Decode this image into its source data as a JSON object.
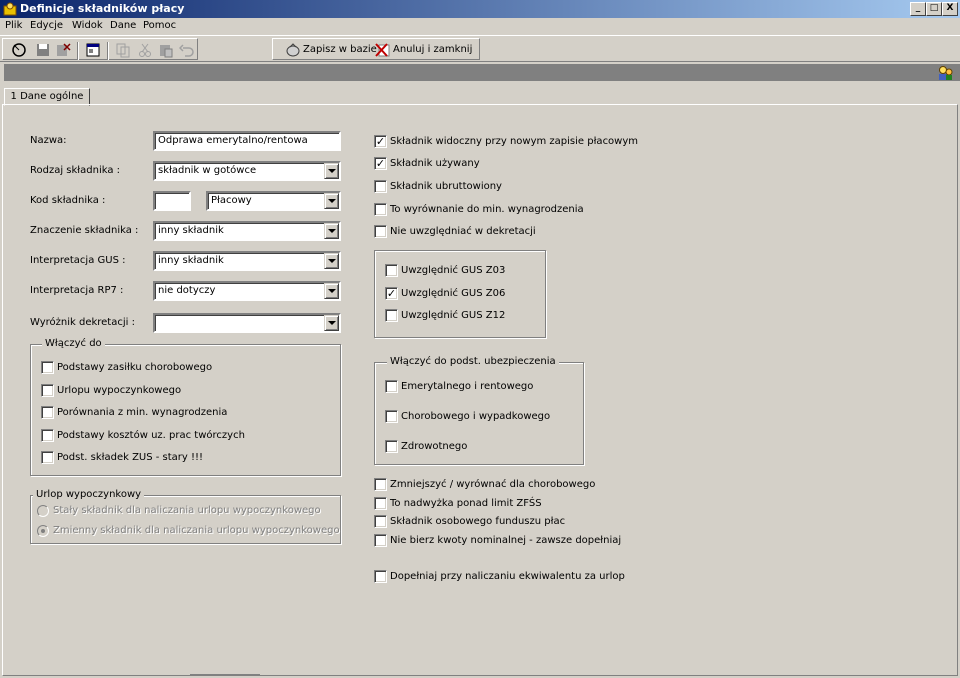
{
  "window": {
    "title": "Definicje składników płacy",
    "min_label": "_",
    "max_label": "□",
    "close_label": "X"
  },
  "menu": [
    "Plik",
    "Edycje",
    "Widok",
    "Dane",
    "Pomoc"
  ],
  "toolbar": {
    "save_label": "Zapisz w bazie",
    "cancel_label": "Anuluj i zamknij"
  },
  "tabs": [
    {
      "label": "1 Dane ogólne"
    }
  ],
  "form": {
    "nazwa": {
      "label": "Nazwa:",
      "value": "Odprawa emerytalno/rentowa"
    },
    "rodzaj": {
      "label": "Rodzaj składnika :",
      "value": "składnik w gotówce"
    },
    "kod": {
      "label": "Kod składnika :",
      "value": "",
      "type_value": "Płacowy"
    },
    "znaczenie": {
      "label": "Znaczenie składnika :",
      "value": "inny składnik"
    },
    "gus": {
      "label": "Interpretacja GUS :",
      "value": "inny składnik"
    },
    "rp7": {
      "label": "Interpretacja RP7 :",
      "value": "nie dotyczy"
    },
    "wyroznik": {
      "label": "Wyróżnik dekretacji :",
      "value": ""
    }
  },
  "wlaczyc_do": {
    "title": "Włączyć do",
    "items": [
      {
        "label": "Podstawy zasiłku chorobowego",
        "checked": false
      },
      {
        "label": "Urlopu wypoczynkowego",
        "checked": false
      },
      {
        "label": "Porównania z min. wynagrodzenia",
        "checked": false
      },
      {
        "label": "Podstawy kosztów uz. prac twórczych",
        "checked": false
      },
      {
        "label": "Podst. składek ZUS - stary !!!",
        "checked": false
      }
    ]
  },
  "urlop": {
    "title": "Urlop wypoczynkowy",
    "options": [
      {
        "label": "Stały składnik dla naliczania urlopu wypoczynkowego",
        "selected": false
      },
      {
        "label": "Zmienny składnik dla naliczania urlopu wypoczynkowego",
        "selected": true
      }
    ]
  },
  "right_checks": [
    {
      "label": "Składnik widoczny przy nowym zapisie płacowym",
      "checked": true
    },
    {
      "label": "Składnik używany",
      "checked": true
    },
    {
      "label": "Składnik ubruttowiony",
      "checked": false
    },
    {
      "label": "To wyrównanie do min. wynagrodzenia",
      "checked": false
    },
    {
      "label": "Nie uwzględniać w dekretacji",
      "checked": false
    }
  ],
  "gus_checks": [
    {
      "label": "Uwzględnić GUS Z03",
      "checked": false
    },
    {
      "label": "Uwzględnić GUS Z06",
      "checked": true
    },
    {
      "label": "Uwzględnić GUS Z12",
      "checked": false
    }
  ],
  "ubezp": {
    "title": "Włączyć do podst. ubezpieczenia",
    "items": [
      {
        "label": "Emerytalnego i rentowego",
        "checked": false
      },
      {
        "label": "Chorobowego i wypadkowego",
        "checked": false
      },
      {
        "label": "Zdrowotnego",
        "checked": false
      }
    ]
  },
  "bottom_checks": [
    {
      "label": "Zmniejszyć / wyrównać dla chorobowego",
      "checked": false
    },
    {
      "label": "To nadwyżka ponad limit ZFŚS",
      "checked": false
    },
    {
      "label": "Składnik osobowego funduszu płac",
      "checked": false
    },
    {
      "label": "Nie bierz kwoty nominalnej - zawsze dopełniaj",
      "checked": false
    },
    {
      "label": "Dopełniaj przy naliczaniu ekwiwalentu za urlop",
      "checked": false
    }
  ],
  "icons": {
    "check_mark": "✓"
  }
}
